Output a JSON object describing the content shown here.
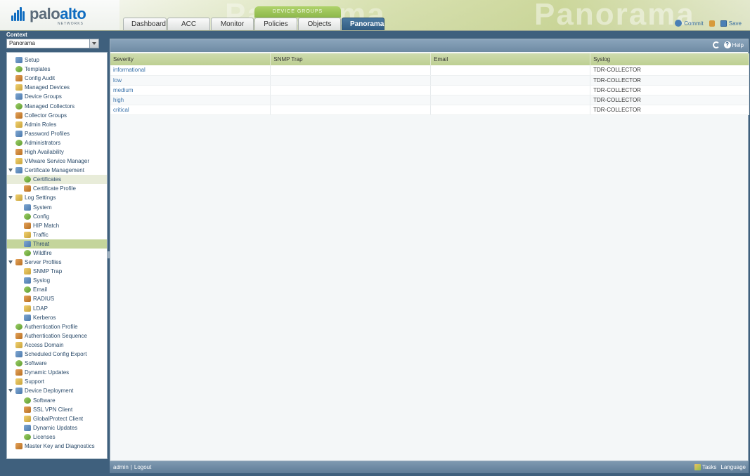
{
  "header": {
    "logo_main": "palo",
    "logo_accent": "alto",
    "logo_sub": "NETWORKS",
    "background_text_1": "Panorama",
    "background_text_2": "Panorama",
    "device_groups_label": "DEVICE GROUPS",
    "tabs": [
      {
        "label": "Dashboard",
        "active": false
      },
      {
        "label": "ACC",
        "active": false
      },
      {
        "label": "Monitor",
        "active": false
      },
      {
        "label": "Policies",
        "active": false
      },
      {
        "label": "Objects",
        "active": false
      },
      {
        "label": "Panorama",
        "active": true
      }
    ],
    "commit_label": "Commit",
    "save_label": "Save"
  },
  "context": {
    "label": "Context",
    "value": "Panorama"
  },
  "nav": {
    "items": [
      {
        "label": "Setup",
        "level": 0,
        "icon": "setup-icon"
      },
      {
        "label": "Templates",
        "level": 0,
        "icon": "templates-icon"
      },
      {
        "label": "Config Audit",
        "level": 0,
        "icon": "config-audit-icon"
      },
      {
        "label": "Managed Devices",
        "level": 0,
        "icon": "managed-devices-icon"
      },
      {
        "label": "Device Groups",
        "level": 0,
        "icon": "device-groups-icon"
      },
      {
        "label": "Managed Collectors",
        "level": 0,
        "icon": "managed-collectors-icon"
      },
      {
        "label": "Collector Groups",
        "level": 0,
        "icon": "collector-groups-icon"
      },
      {
        "label": "Admin Roles",
        "level": 0,
        "icon": "admin-roles-icon"
      },
      {
        "label": "Password Profiles",
        "level": 0,
        "icon": "password-profiles-icon"
      },
      {
        "label": "Administrators",
        "level": 0,
        "icon": "administrators-icon"
      },
      {
        "label": "High Availability",
        "level": 0,
        "icon": "high-availability-icon"
      },
      {
        "label": "VMware Service Manager",
        "level": 0,
        "icon": "vmware-icon"
      },
      {
        "label": "Certificate Management",
        "level": 0,
        "icon": "certificate-management-icon",
        "expanded": true
      },
      {
        "label": "Certificates",
        "level": 1,
        "icon": "certificate-icon",
        "state": "hover"
      },
      {
        "label": "Certificate Profile",
        "level": 1,
        "icon": "certificate-profile-icon"
      },
      {
        "label": "Log Settings",
        "level": 0,
        "icon": "log-settings-icon",
        "expanded": true
      },
      {
        "label": "System",
        "level": 1,
        "icon": "system-log-icon"
      },
      {
        "label": "Config",
        "level": 1,
        "icon": "config-log-icon"
      },
      {
        "label": "HIP Match",
        "level": 1,
        "icon": "hip-match-icon"
      },
      {
        "label": "Traffic",
        "level": 1,
        "icon": "traffic-log-icon"
      },
      {
        "label": "Threat",
        "level": 1,
        "icon": "threat-log-icon",
        "state": "selected"
      },
      {
        "label": "Wildfire",
        "level": 1,
        "icon": "wildfire-icon"
      },
      {
        "label": "Server Profiles",
        "level": 0,
        "icon": "server-profiles-icon",
        "expanded": true
      },
      {
        "label": "SNMP Trap",
        "level": 1,
        "icon": "snmp-trap-icon"
      },
      {
        "label": "Syslog",
        "level": 1,
        "icon": "syslog-icon"
      },
      {
        "label": "Email",
        "level": 1,
        "icon": "email-icon"
      },
      {
        "label": "RADIUS",
        "level": 1,
        "icon": "radius-icon"
      },
      {
        "label": "LDAP",
        "level": 1,
        "icon": "ldap-icon"
      },
      {
        "label": "Kerberos",
        "level": 1,
        "icon": "kerberos-icon"
      },
      {
        "label": "Authentication Profile",
        "level": 0,
        "icon": "authentication-profile-icon"
      },
      {
        "label": "Authentication Sequence",
        "level": 0,
        "icon": "authentication-sequence-icon"
      },
      {
        "label": "Access Domain",
        "level": 0,
        "icon": "access-domain-icon"
      },
      {
        "label": "Scheduled Config Export",
        "level": 0,
        "icon": "scheduled-export-icon"
      },
      {
        "label": "Software",
        "level": 0,
        "icon": "software-icon"
      },
      {
        "label": "Dynamic Updates",
        "level": 0,
        "icon": "dynamic-updates-icon"
      },
      {
        "label": "Support",
        "level": 0,
        "icon": "support-icon"
      },
      {
        "label": "Device Deployment",
        "level": 0,
        "icon": "device-deployment-icon",
        "expanded": true
      },
      {
        "label": "Software",
        "level": 1,
        "icon": "software-icon"
      },
      {
        "label": "SSL VPN Client",
        "level": 1,
        "icon": "ssl-vpn-icon"
      },
      {
        "label": "GlobalProtect Client",
        "level": 1,
        "icon": "globalprotect-icon"
      },
      {
        "label": "Dynamic Updates",
        "level": 1,
        "icon": "dynamic-updates-icon"
      },
      {
        "label": "Licenses",
        "level": 1,
        "icon": "licenses-icon"
      },
      {
        "label": "Master Key and Diagnostics",
        "level": 0,
        "icon": "master-key-icon"
      }
    ]
  },
  "toolbar": {
    "help_label": "Help"
  },
  "table": {
    "columns": [
      "Severity",
      "SNMP Trap",
      "Email",
      "Syslog"
    ],
    "rows": [
      {
        "severity": "informational",
        "snmp": "",
        "email": "",
        "syslog": "TDR-COLLECTOR"
      },
      {
        "severity": "low",
        "snmp": "",
        "email": "",
        "syslog": "TDR-COLLECTOR"
      },
      {
        "severity": "medium",
        "snmp": "",
        "email": "",
        "syslog": "TDR-COLLECTOR"
      },
      {
        "severity": "high",
        "snmp": "",
        "email": "",
        "syslog": "TDR-COLLECTOR"
      },
      {
        "severity": "critical",
        "snmp": "",
        "email": "",
        "syslog": "TDR-COLLECTOR"
      }
    ]
  },
  "footer": {
    "user": "admin",
    "separator": "|",
    "logout": "Logout",
    "tasks": "Tasks",
    "language": "Language"
  }
}
